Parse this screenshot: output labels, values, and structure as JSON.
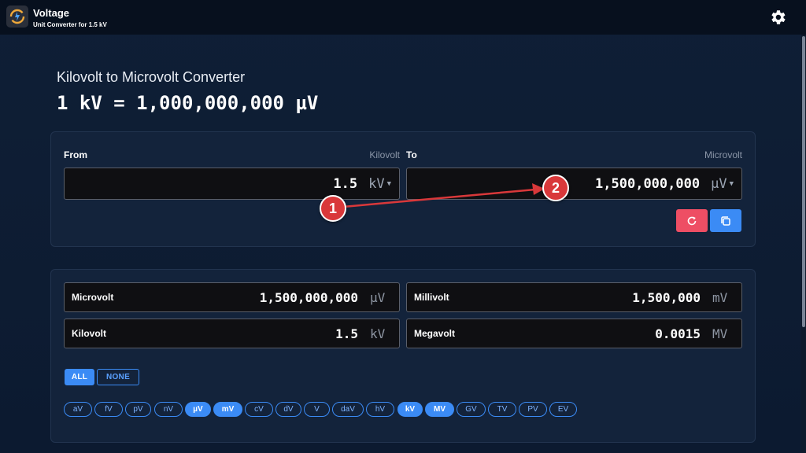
{
  "app": {
    "title": "Voltage",
    "subtitle": "Unit Converter for 1.5 kV",
    "settings_icon": "gear-icon",
    "logo_icon": "voltage-convert-logo"
  },
  "page": {
    "heading": "Kilovolt to Microvolt Converter",
    "equation": "1 kV = 1,000,000,000 µV"
  },
  "converter": {
    "from": {
      "label": "From",
      "unit_name": "Kilovolt",
      "value": "1.5",
      "unit_symbol": "kV"
    },
    "to": {
      "label": "To",
      "unit_name": "Microvolt",
      "value": "1,500,000,000",
      "unit_symbol": "µV"
    },
    "buttons": {
      "reset_icon": "reset-icon",
      "copy_icon": "copy-icon"
    },
    "colors": {
      "reset": "#ee4e64",
      "copy": "#3b8bf5"
    }
  },
  "results": [
    {
      "name": "Microvolt",
      "value": "1,500,000,000",
      "unit": "µV"
    },
    {
      "name": "Millivolt",
      "value": "1,500,000",
      "unit": "mV"
    },
    {
      "name": "Kilovolt",
      "value": "1.5",
      "unit": "kV"
    },
    {
      "name": "Megavolt",
      "value": "0.0015",
      "unit": "MV"
    }
  ],
  "filters": {
    "all_label": "ALL",
    "none_label": "NONE",
    "units": [
      {
        "label": "aV",
        "selected": false
      },
      {
        "label": "fV",
        "selected": false
      },
      {
        "label": "pV",
        "selected": false
      },
      {
        "label": "nV",
        "selected": false
      },
      {
        "label": "µV",
        "selected": true
      },
      {
        "label": "mV",
        "selected": true
      },
      {
        "label": "cV",
        "selected": false
      },
      {
        "label": "dV",
        "selected": false
      },
      {
        "label": "V",
        "selected": false
      },
      {
        "label": "daV",
        "selected": false
      },
      {
        "label": "hV",
        "selected": false
      },
      {
        "label": "kV",
        "selected": true
      },
      {
        "label": "MV",
        "selected": true
      },
      {
        "label": "GV",
        "selected": false
      },
      {
        "label": "TV",
        "selected": false
      },
      {
        "label": "PV",
        "selected": false
      },
      {
        "label": "EV",
        "selected": false
      }
    ]
  },
  "annotations": [
    {
      "number": "1"
    },
    {
      "number": "2"
    }
  ],
  "colors": {
    "accent": "#3b8bf5",
    "background": "#0f1f36",
    "card": "#13233b",
    "annotation": "#d9383a"
  }
}
